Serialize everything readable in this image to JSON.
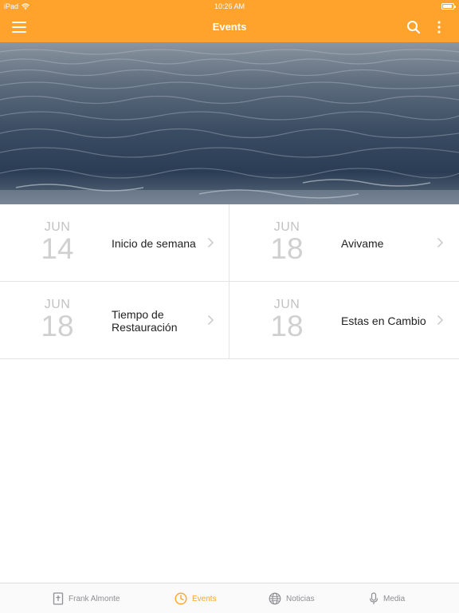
{
  "status_bar": {
    "device": "iPad",
    "time": "10:26 AM",
    "battery_level": 0.9
  },
  "app_bar": {
    "title": "Events",
    "menu_icon": "menu-icon",
    "search_icon": "search-icon",
    "more_icon": "more-vertical-icon"
  },
  "colors": {
    "accent": "#ffa32c",
    "text": "#222222",
    "muted": "#c2c2c2",
    "tab_inactive": "#8e8e93"
  },
  "events": [
    {
      "month": "JUN",
      "day": "14",
      "title": "Inicio de semana"
    },
    {
      "month": "JUN",
      "day": "18",
      "title": "Avivame"
    },
    {
      "month": "JUN",
      "day": "18",
      "title": "Tiempo de Restauración"
    },
    {
      "month": "JUN",
      "day": "18",
      "title": "Estas en Cambio"
    }
  ],
  "tabs": [
    {
      "label": "Frank Almonte",
      "icon": "book-cross-icon",
      "active": false
    },
    {
      "label": "Events",
      "icon": "clock-icon",
      "active": true
    },
    {
      "label": "Noticias",
      "icon": "globe-icon",
      "active": false
    },
    {
      "label": "Media",
      "icon": "microphone-icon",
      "active": false
    }
  ]
}
